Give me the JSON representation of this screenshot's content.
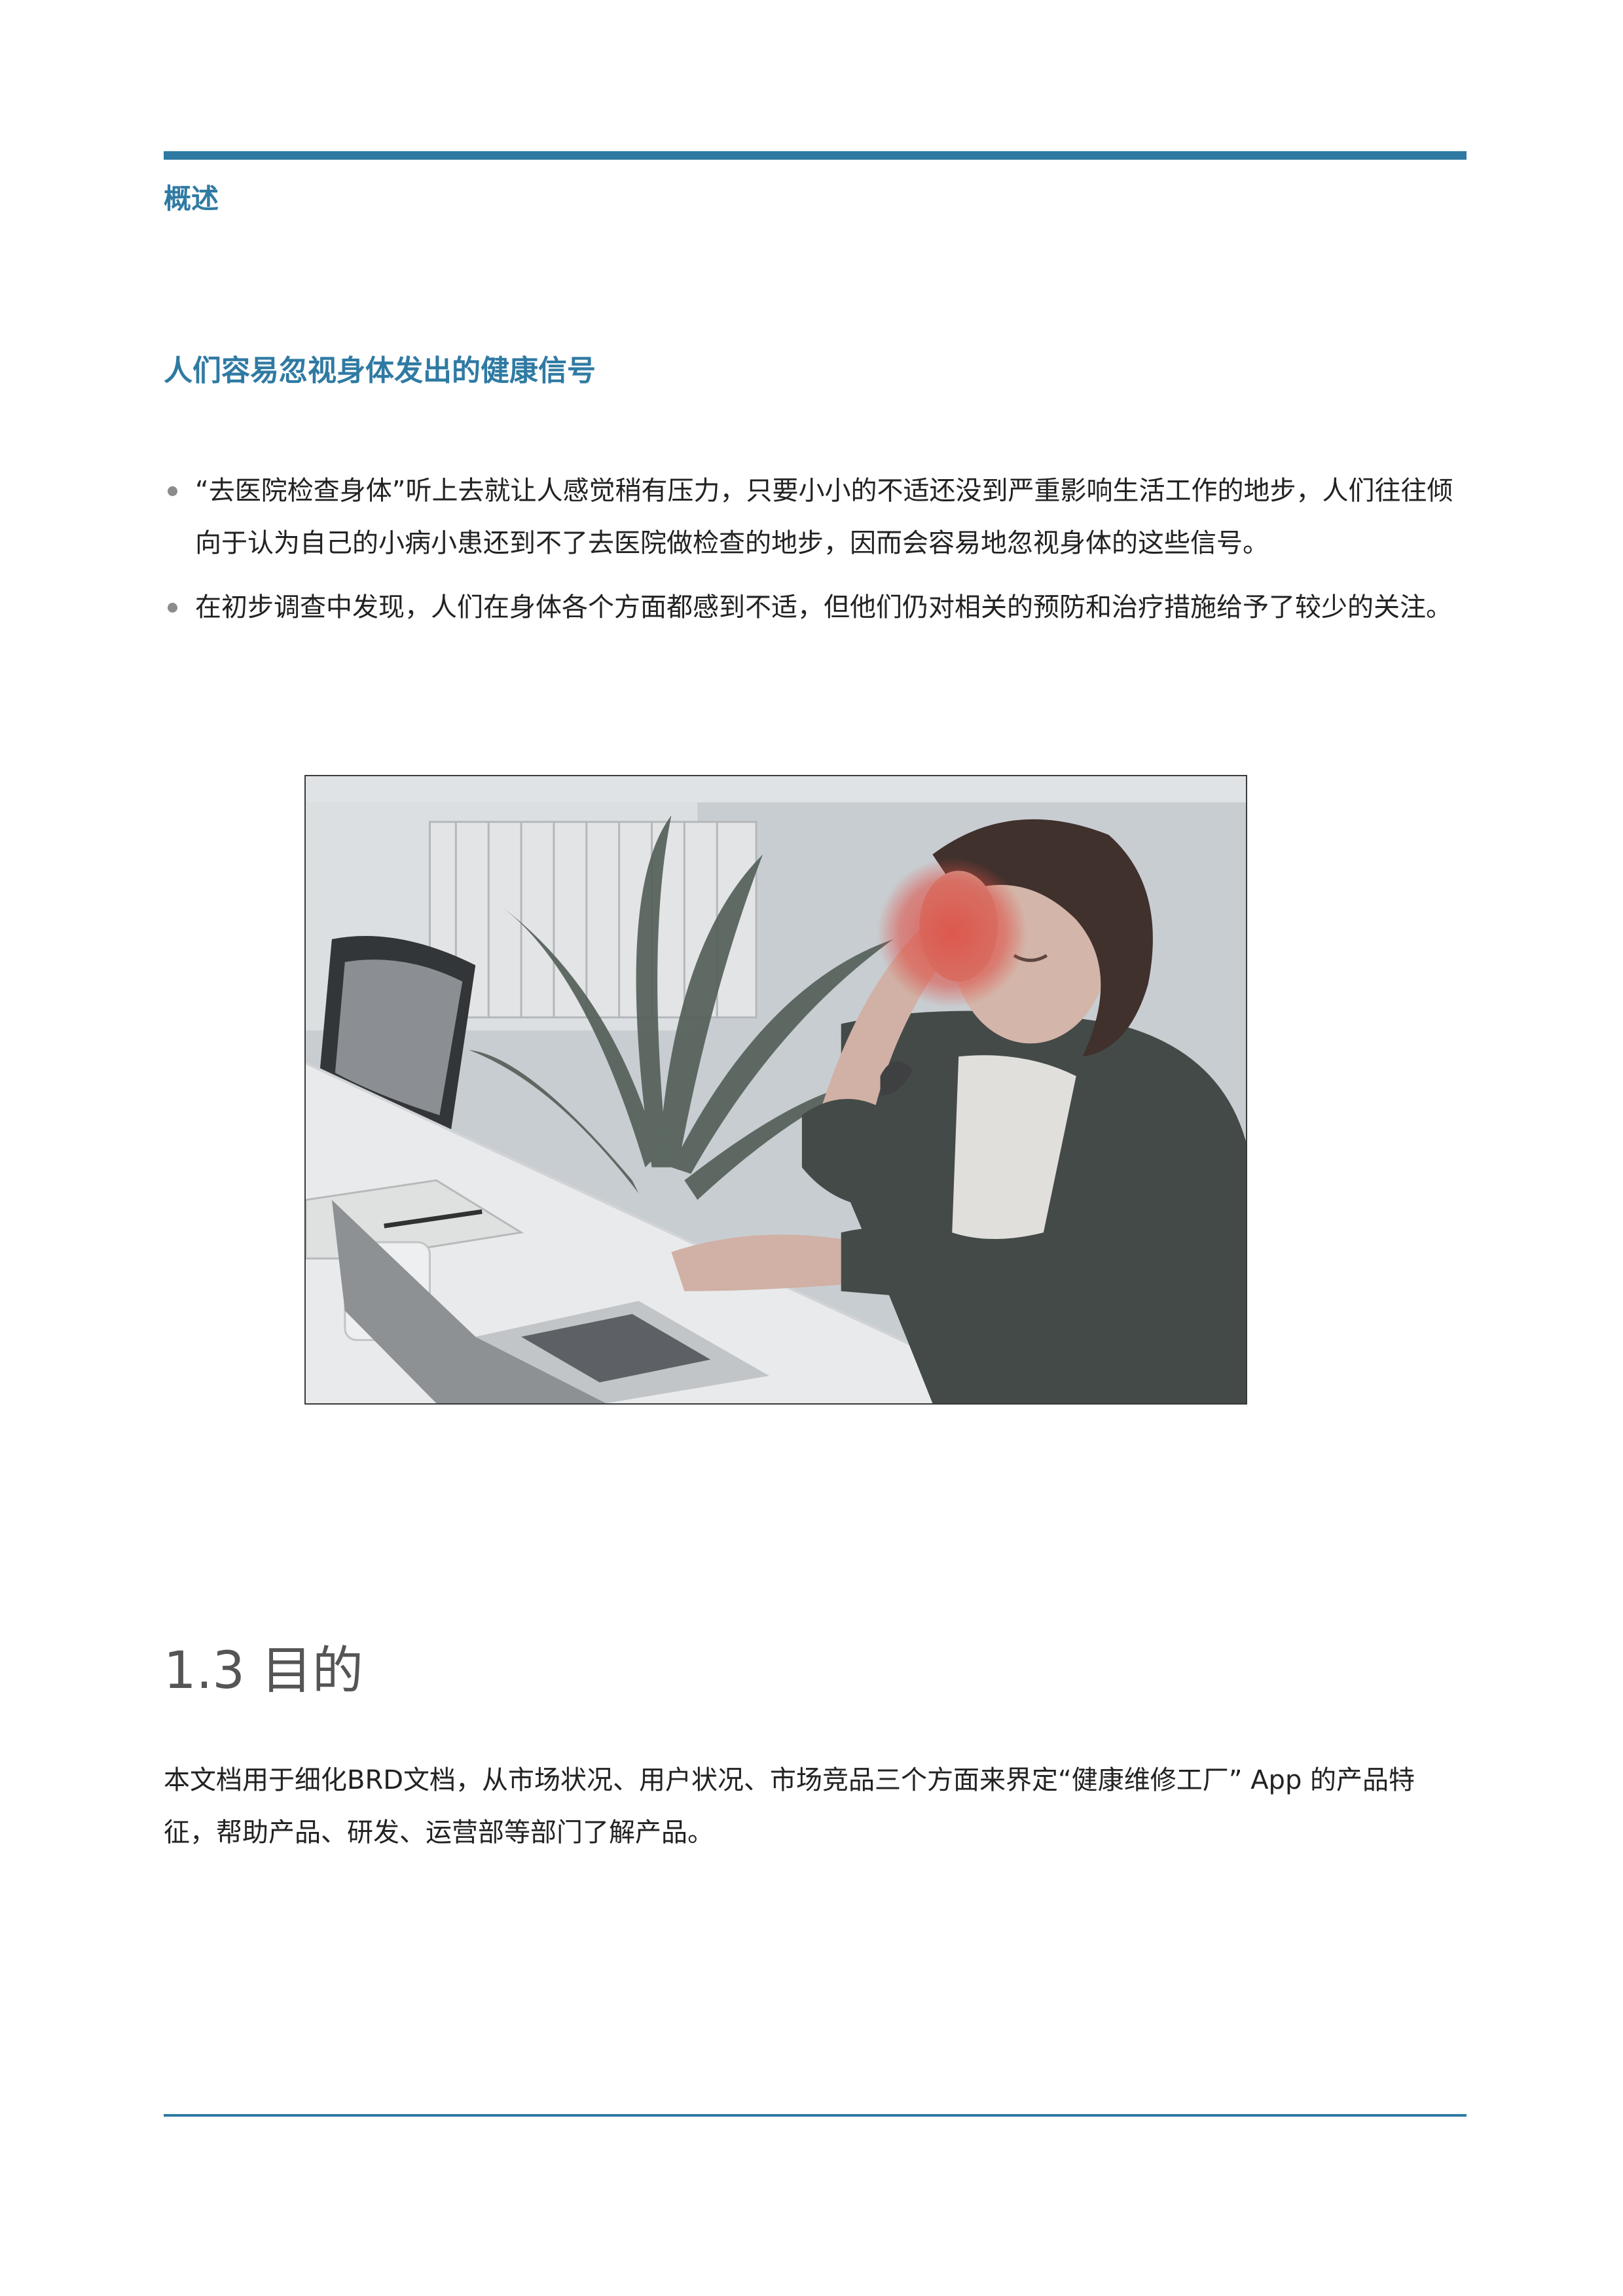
{
  "header": {
    "section_label": "概述"
  },
  "overview": {
    "subheading": "人们容易忽视身体发出的健康信号",
    "bullets": [
      "“去医院检查身体”听上去就让人感觉稍有压力，只要小小的不适还没到严重影响生活工作的地步，人们往往倾向于认为自己的小病小患还到不了去医院做检查的地步，因而会容易地忽视身体的这些信号。",
      "在初步调查中发现，人们在身体各个方面都感到不适，但他们仍对相关的预防和治疗措施给予了较少的关注。"
    ]
  },
  "purpose": {
    "heading": "1.3 目的",
    "paragraph": "本文档用于细化BRD文档，从市场状况、用户状况、市场竞品三个方面来界定“健康维修工厂” App 的产品特征，帮助产品、研发、运营部等部门了解产品。"
  },
  "colors": {
    "accent": "#2f7aa3",
    "highlight": "#e8463a"
  }
}
